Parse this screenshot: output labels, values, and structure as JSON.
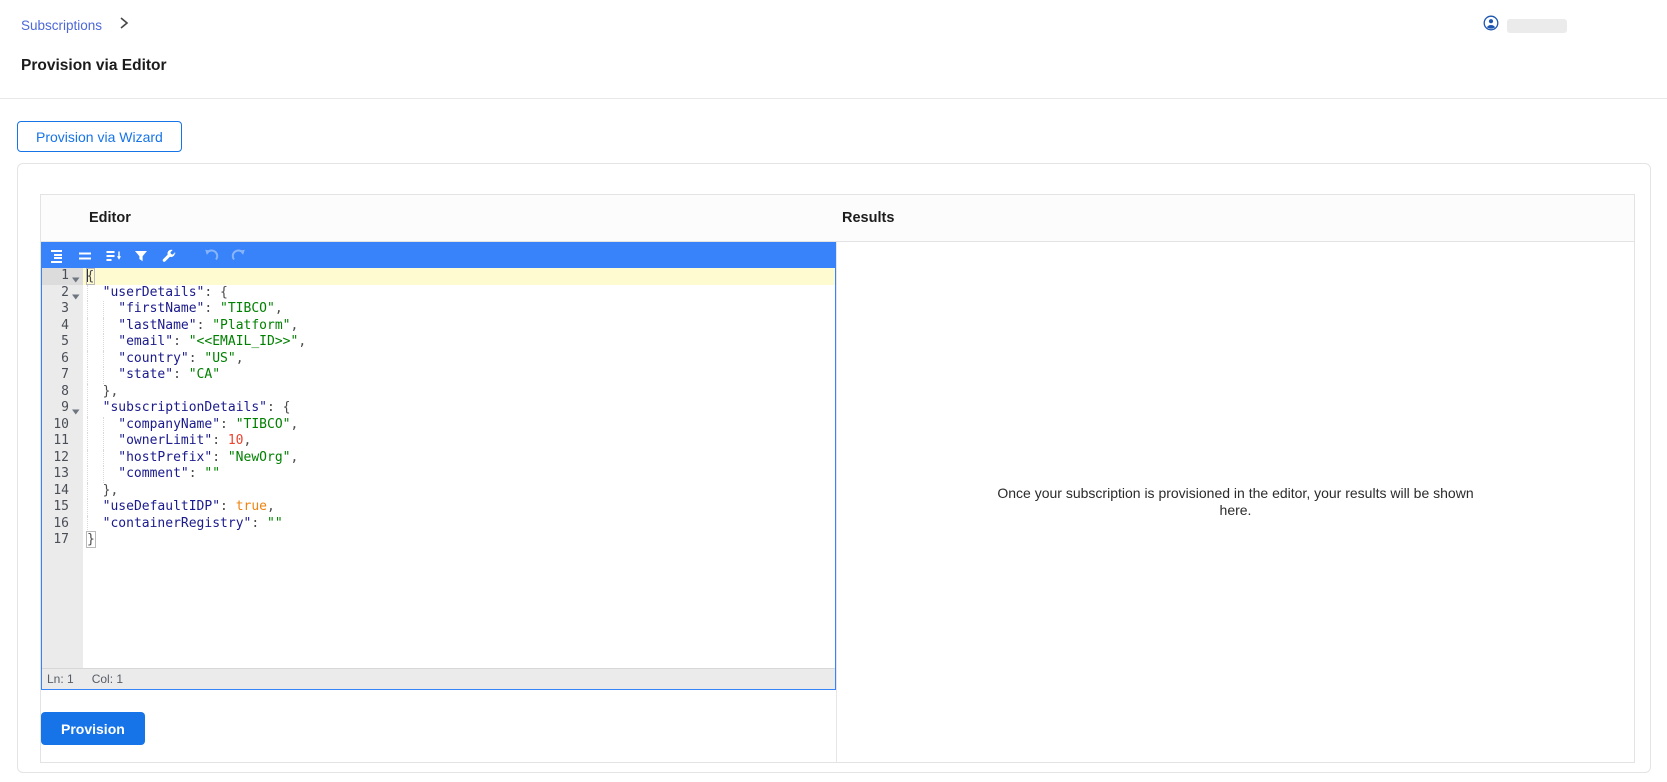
{
  "breadcrumb": {
    "items": [
      {
        "label": "Subscriptions"
      }
    ]
  },
  "page_title": "Provision via Editor",
  "user_menu": {
    "avatar_icon": "user-circle-icon",
    "name_redacted": true
  },
  "buttons": {
    "provision_via_wizard": "Provision via Wizard",
    "provision": "Provision"
  },
  "panel_headers": {
    "editor": "Editor",
    "results": "Results"
  },
  "results": {
    "placeholder": "Once your subscription is provisioned in the editor, your results will be shown here."
  },
  "editor": {
    "toolbar": [
      {
        "icon": "format-icon",
        "disabled": false
      },
      {
        "icon": "compact-icon",
        "disabled": false
      },
      {
        "icon": "sort-icon",
        "disabled": false
      },
      {
        "icon": "transform-icon",
        "disabled": false
      },
      {
        "icon": "repair-icon",
        "disabled": false
      },
      {
        "icon": "undo-icon",
        "disabled": true,
        "group": "history"
      },
      {
        "icon": "redo-icon",
        "disabled": true,
        "group": "history"
      }
    ],
    "statusbar": {
      "line": "Ln: 1",
      "column": "Col: 1"
    },
    "json_lines": [
      {
        "num": 1,
        "fold": true,
        "active": true,
        "indent": 0,
        "tokens": [
          [
            "pm",
            "{"
          ]
        ]
      },
      {
        "num": 2,
        "fold": true,
        "indent": 1,
        "tokens": [
          [
            "k",
            "\"userDetails\""
          ],
          [
            "p",
            ": {"
          ]
        ]
      },
      {
        "num": 3,
        "indent": 2,
        "tokens": [
          [
            "k",
            "\"firstName\""
          ],
          [
            "p",
            ": "
          ],
          [
            "s",
            "\"TIBCO\""
          ],
          [
            "p",
            ","
          ]
        ]
      },
      {
        "num": 4,
        "indent": 2,
        "tokens": [
          [
            "k",
            "\"lastName\""
          ],
          [
            "p",
            ": "
          ],
          [
            "s",
            "\"Platform\""
          ],
          [
            "p",
            ","
          ]
        ]
      },
      {
        "num": 5,
        "indent": 2,
        "tokens": [
          [
            "k",
            "\"email\""
          ],
          [
            "p",
            ": "
          ],
          [
            "s",
            "\"<<EMAIL_ID>>\""
          ],
          [
            "p",
            ","
          ]
        ]
      },
      {
        "num": 6,
        "indent": 2,
        "tokens": [
          [
            "k",
            "\"country\""
          ],
          [
            "p",
            ": "
          ],
          [
            "s",
            "\"US\""
          ],
          [
            "p",
            ","
          ]
        ]
      },
      {
        "num": 7,
        "indent": 2,
        "tokens": [
          [
            "k",
            "\"state\""
          ],
          [
            "p",
            ": "
          ],
          [
            "s",
            "\"CA\""
          ]
        ]
      },
      {
        "num": 8,
        "indent": 1,
        "tokens": [
          [
            "p",
            "},"
          ]
        ]
      },
      {
        "num": 9,
        "fold": true,
        "indent": 1,
        "tokens": [
          [
            "k",
            "\"subscriptionDetails\""
          ],
          [
            "p",
            ": {"
          ]
        ]
      },
      {
        "num": 10,
        "indent": 2,
        "tokens": [
          [
            "k",
            "\"companyName\""
          ],
          [
            "p",
            ": "
          ],
          [
            "s",
            "\"TIBCO\""
          ],
          [
            "p",
            ","
          ]
        ]
      },
      {
        "num": 11,
        "indent": 2,
        "tokens": [
          [
            "k",
            "\"ownerLimit\""
          ],
          [
            "p",
            ": "
          ],
          [
            "n",
            "10"
          ],
          [
            "p",
            ","
          ]
        ]
      },
      {
        "num": 12,
        "indent": 2,
        "tokens": [
          [
            "k",
            "\"hostPrefix\""
          ],
          [
            "p",
            ": "
          ],
          [
            "s",
            "\"NewOrg\""
          ],
          [
            "p",
            ","
          ]
        ]
      },
      {
        "num": 13,
        "indent": 2,
        "tokens": [
          [
            "k",
            "\"comment\""
          ],
          [
            "p",
            ": "
          ],
          [
            "s",
            "\"\""
          ]
        ]
      },
      {
        "num": 14,
        "indent": 1,
        "tokens": [
          [
            "p",
            "},"
          ]
        ]
      },
      {
        "num": 15,
        "indent": 1,
        "tokens": [
          [
            "k",
            "\"useDefaultIDP\""
          ],
          [
            "p",
            ": "
          ],
          [
            "b",
            "true"
          ],
          [
            "p",
            ","
          ]
        ]
      },
      {
        "num": 16,
        "indent": 1,
        "tokens": [
          [
            "k",
            "\"containerRegistry\""
          ],
          [
            "p",
            ": "
          ],
          [
            "s",
            "\"\""
          ]
        ]
      },
      {
        "num": 17,
        "indent": 0,
        "tokens": [
          [
            "pm",
            "}"
          ]
        ]
      }
    ]
  },
  "colors": {
    "menu_accent": "#3883fa",
    "primary_button": "#1774e8",
    "link": "#4d68d8",
    "key": "#1a1a8c",
    "string": "#008000",
    "number": "#ee422e",
    "boolean": "#ee8310",
    "active_line": "#fffbd1"
  }
}
